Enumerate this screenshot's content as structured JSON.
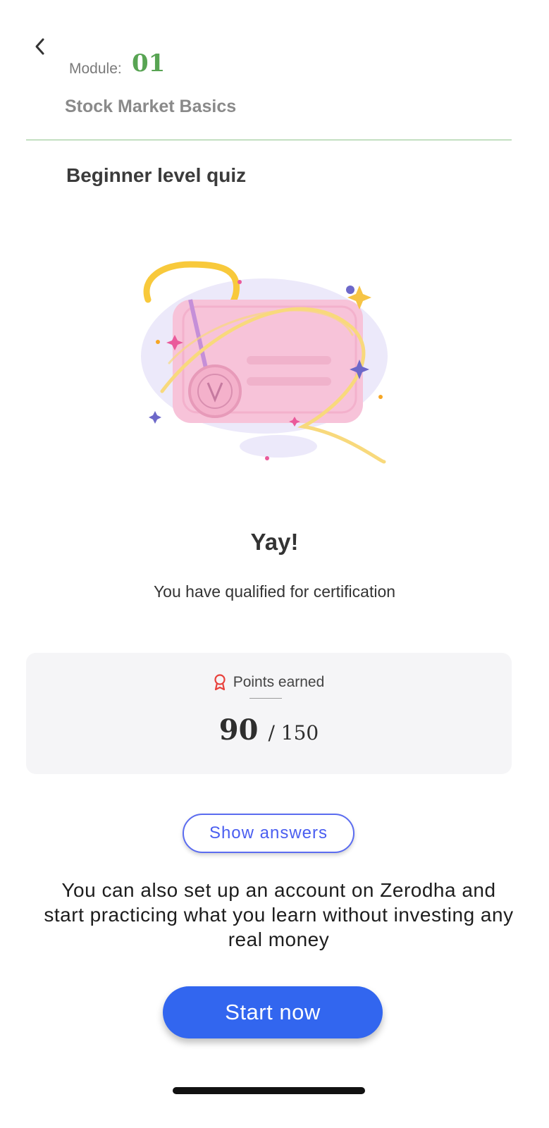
{
  "header": {
    "module_label": "Module:",
    "module_number": "01",
    "module_title": "Stock Market Basics"
  },
  "quiz": {
    "title": "Beginner level quiz",
    "result_heading": "Yay!",
    "result_message": "You have qualified for certification"
  },
  "points": {
    "label": "Points earned",
    "earned": "90",
    "total": "/ 150"
  },
  "buttons": {
    "show_answers": "Show answers",
    "start_now": "Start now"
  },
  "promo_text": "You can also set up an account on Zerodha and start practicing what you learn without investing any real money",
  "icons": {
    "back": "chevron-left-icon",
    "points": "award-ribbon-icon",
    "illustration": "certificate-medal-illustration"
  },
  "colors": {
    "accent_green": "#58a453",
    "primary_blue": "#3266ef",
    "outline_blue": "#5b6cf0",
    "award_red": "#e8413c"
  }
}
